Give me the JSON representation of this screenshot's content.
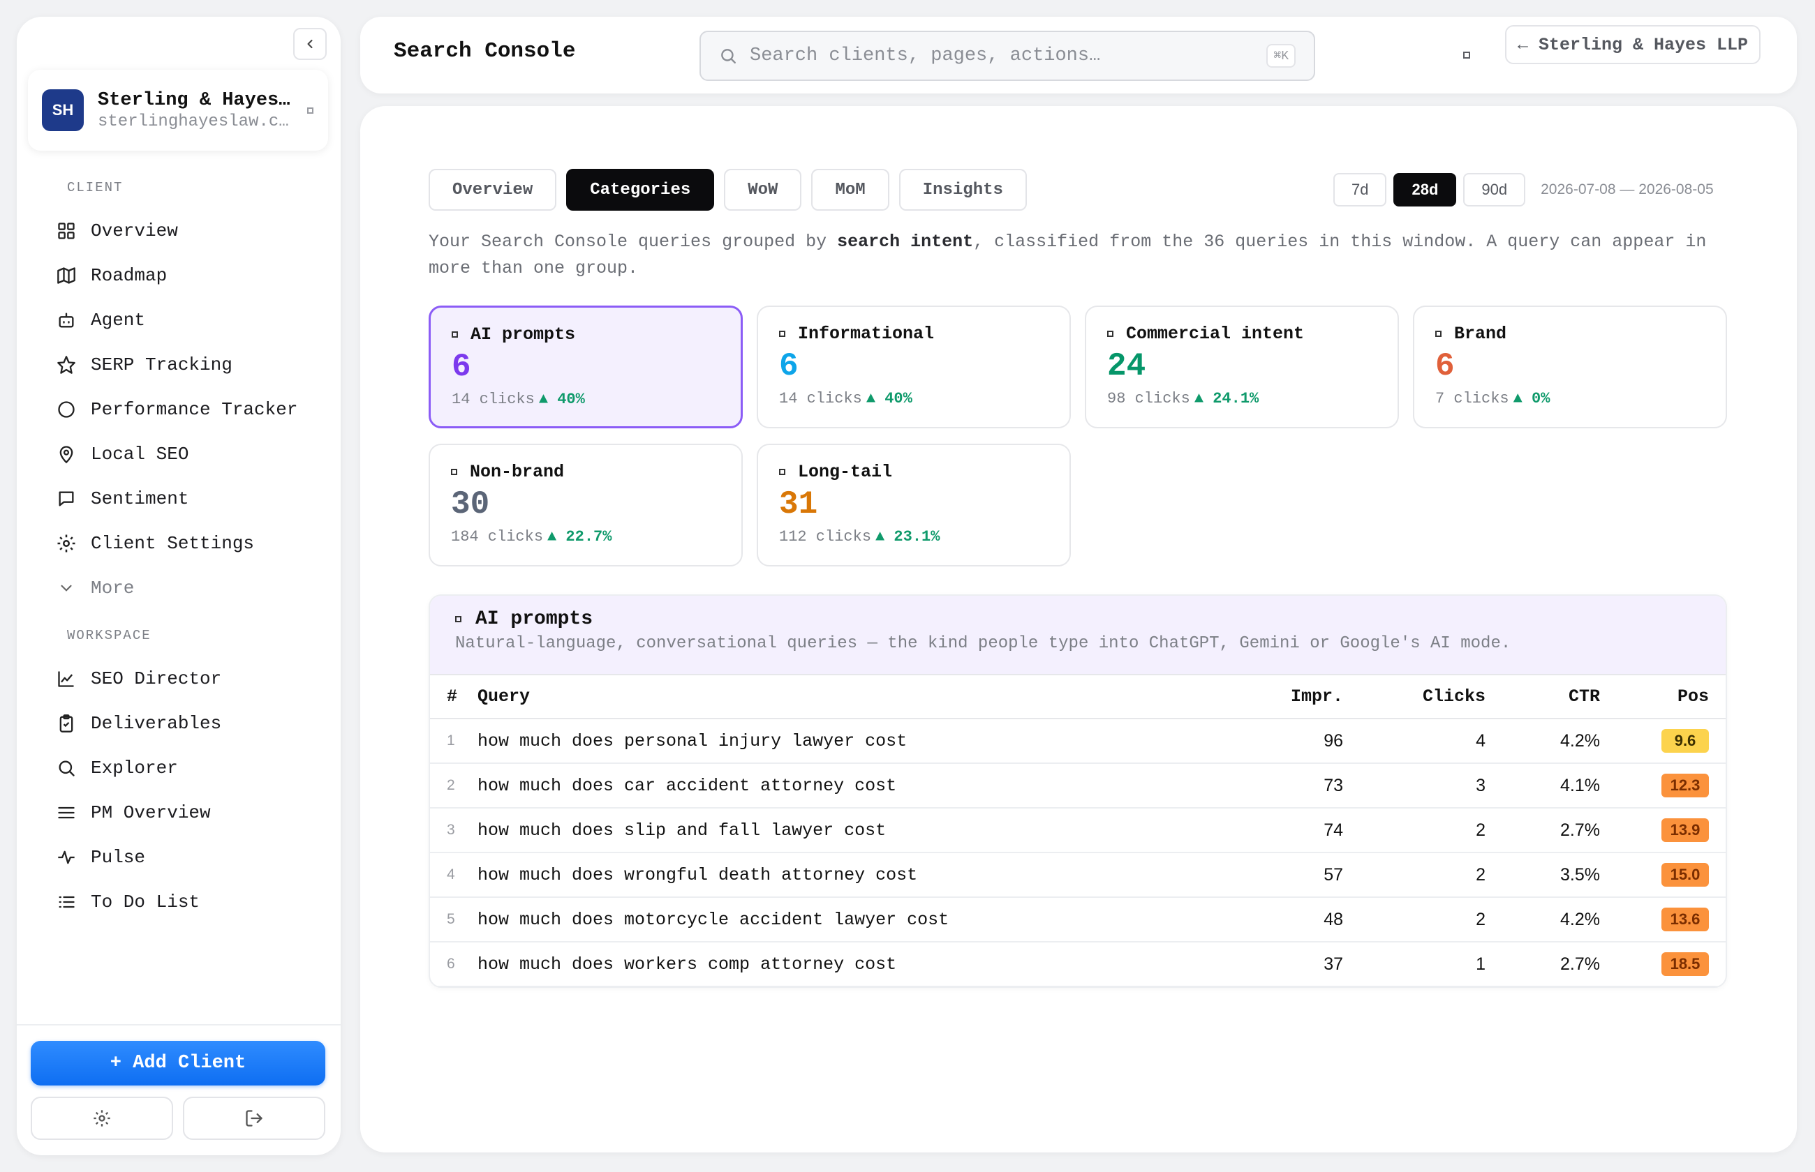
{
  "sidebar": {
    "client": {
      "initials": "SH",
      "name": "Sterling & Hayes…",
      "domain": "sterlinghayeslaw.c…"
    },
    "client_section_title": "CLIENT",
    "client_items": [
      {
        "label": "Overview",
        "icon": "grid-icon"
      },
      {
        "label": "Roadmap",
        "icon": "map-icon"
      },
      {
        "label": "Agent",
        "icon": "bot-icon"
      },
      {
        "label": "SERP Tracking",
        "icon": "star-icon"
      },
      {
        "label": "Performance Tracker",
        "icon": "circle-icon"
      },
      {
        "label": "Local SEO",
        "icon": "map-pin-icon"
      },
      {
        "label": "Sentiment",
        "icon": "message-icon"
      },
      {
        "label": "Client Settings",
        "icon": "gear-icon"
      },
      {
        "label": "More",
        "icon": "chevron-down-icon"
      }
    ],
    "workspace_section_title": "WORKSPACE",
    "workspace_items": [
      {
        "label": "SEO Director",
        "icon": "line-chart-icon"
      },
      {
        "label": "Deliverables",
        "icon": "clipboard-icon"
      },
      {
        "label": "Explorer",
        "icon": "search-icon"
      },
      {
        "label": "PM Overview",
        "icon": "menu-icon"
      },
      {
        "label": "Pulse",
        "icon": "activity-icon"
      },
      {
        "label": "To Do List",
        "icon": "list-icon"
      }
    ],
    "add_client_label": "+ Add Client"
  },
  "topbar": {
    "title": "Search Console",
    "search_placeholder": "Search clients, pages, actions…",
    "search_shortcut": "⌘K",
    "back_label": "← Sterling & Hayes LLP"
  },
  "tabs": [
    "Overview",
    "Categories",
    "WoW",
    "MoM",
    "Insights"
  ],
  "active_tab": "Categories",
  "ranges": [
    "7d",
    "28d",
    "90d"
  ],
  "active_range": "28d",
  "date_range": "2026-07-08 — 2026-08-05",
  "intro": {
    "before": "Your Search Console queries grouped by ",
    "bold": "search intent",
    "after": ", classified from the 36 queries in this window. A query can appear in more than one group."
  },
  "categories": [
    {
      "name": "AI prompts",
      "count": "6",
      "clicks": "14 clicks",
      "delta": "▲ 40%",
      "color": "#7c3aed",
      "selected": true
    },
    {
      "name": "Informational",
      "count": "6",
      "clicks": "14 clicks",
      "delta": "▲ 40%",
      "color": "#0ea5e9",
      "selected": false
    },
    {
      "name": "Commercial intent",
      "count": "24",
      "clicks": "98 clicks",
      "delta": "▲ 24.1%",
      "color": "#059669",
      "selected": false
    },
    {
      "name": "Brand",
      "count": "6",
      "clicks": "7 clicks",
      "delta": "▲ 0%",
      "color": "#e0603a",
      "selected": false
    },
    {
      "name": "Non-brand",
      "count": "30",
      "clicks": "184 clicks",
      "delta": "▲ 22.7%",
      "color": "#5b6577",
      "selected": false
    },
    {
      "name": "Long-tail",
      "count": "31",
      "clicks": "112 clicks",
      "delta": "▲ 23.1%",
      "color": "#d97706",
      "selected": false
    }
  ],
  "detail": {
    "title": "AI prompts",
    "description": "Natural-language, conversational queries — the kind people type into ChatGPT, Gemini or Google's AI mode.",
    "columns": [
      "#",
      "Query",
      "Impr.",
      "Clicks",
      "CTR",
      "Pos"
    ],
    "rows": [
      {
        "n": "1",
        "query": "how much does personal injury lawyer cost",
        "impr": "96",
        "clicks": "4",
        "ctr": "4.2%",
        "pos": "9.6",
        "pos_bg": "#fcd34d",
        "pos_fg": "#3b2f00"
      },
      {
        "n": "2",
        "query": "how much does car accident attorney cost",
        "impr": "73",
        "clicks": "3",
        "ctr": "4.1%",
        "pos": "12.3",
        "pos_bg": "#fb923c",
        "pos_fg": "#7a2d00"
      },
      {
        "n": "3",
        "query": "how much does slip and fall lawyer cost",
        "impr": "74",
        "clicks": "2",
        "ctr": "2.7%",
        "pos": "13.9",
        "pos_bg": "#fb923c",
        "pos_fg": "#7a2d00"
      },
      {
        "n": "4",
        "query": "how much does wrongful death attorney cost",
        "impr": "57",
        "clicks": "2",
        "ctr": "3.5%",
        "pos": "15.0",
        "pos_bg": "#fb923c",
        "pos_fg": "#7a2d00"
      },
      {
        "n": "5",
        "query": "how much does motorcycle accident lawyer cost",
        "impr": "48",
        "clicks": "2",
        "ctr": "4.2%",
        "pos": "13.6",
        "pos_bg": "#fb923c",
        "pos_fg": "#7a2d00"
      },
      {
        "n": "6",
        "query": "how much does workers comp attorney cost",
        "impr": "37",
        "clicks": "1",
        "ctr": "2.7%",
        "pos": "18.5",
        "pos_bg": "#fb923c",
        "pos_fg": "#7a2d00"
      }
    ]
  }
}
